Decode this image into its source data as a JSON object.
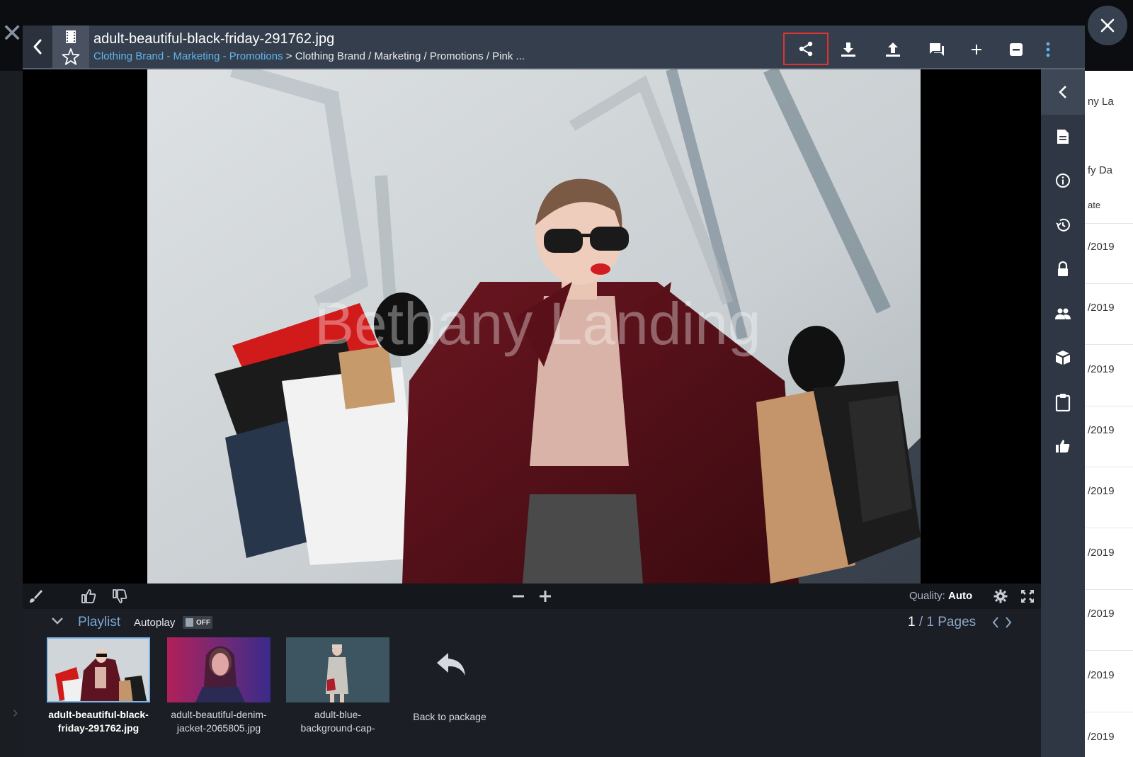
{
  "header": {
    "title": "adult-beautiful-black-friday-291762.jpg",
    "breadcrumb_link": "Clothing Brand - Marketing - Promotions",
    "breadcrumb_path": " > Clothing Brand / Marketing / Promotions / Pink ..."
  },
  "image": {
    "watermark": "Bethany Landing"
  },
  "toolbar": {
    "quality_label": "Quality:",
    "quality_value": "Auto"
  },
  "playlist": {
    "title": "Playlist",
    "autoplay_label": "Autoplay",
    "autoplay_state": "OFF",
    "page_current": "1",
    "page_suffix": " / 1 Pages",
    "items": [
      {
        "label_line1": "adult-beautiful-black-",
        "label_line2": "friday-291762.jpg"
      },
      {
        "label_line1": "adult-beautiful-denim-",
        "label_line2": "jacket-2065805.jpg"
      },
      {
        "label_line1": "adult-blue-",
        "label_line2": "background-cap-"
      }
    ],
    "back_to_package": "Back to package"
  },
  "background": {
    "right_texts": [
      "ny La",
      "fy Da",
      "ate",
      "/2019",
      "/2019",
      "/2019",
      "/2019",
      "/2019",
      "/2019",
      "/2019",
      "/2019",
      "/2019"
    ]
  },
  "colors": {
    "header_bg": "#353e4d",
    "share_highlight": "#e0342c",
    "link": "#5fb4ec",
    "playlist_accent": "#7aa8dc"
  }
}
